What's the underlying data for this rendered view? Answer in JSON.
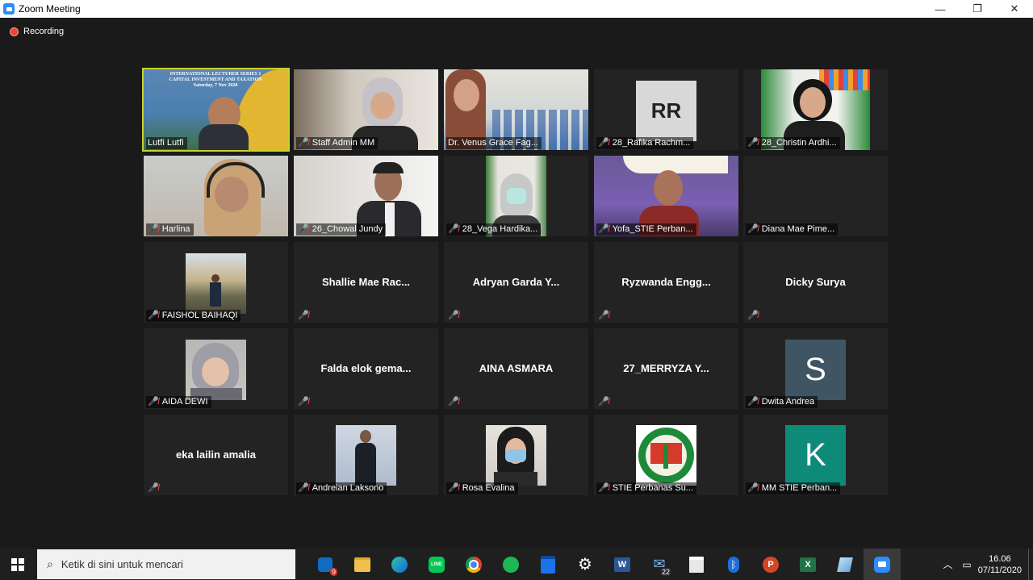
{
  "window": {
    "title": "Zoom Meeting",
    "minimize": "—",
    "maximize": "❐",
    "close": "✕"
  },
  "recording": {
    "label": "Recording"
  },
  "participants": [
    {
      "name": "Lutfi Lutfi",
      "kind": "video",
      "muted": false,
      "active": true
    },
    {
      "name": "Staff Admin MM",
      "kind": "video",
      "muted": true
    },
    {
      "name": "Dr. Venus Grace Fag...",
      "kind": "video",
      "muted": false
    },
    {
      "name": "28_Rafika Rachm...",
      "kind": "avatar",
      "avatar_text": "RR",
      "avatar_color": "#d8d8d8",
      "muted": true
    },
    {
      "name": "28_Christin Ardhi...",
      "kind": "video",
      "muted": true
    },
    {
      "name": "Harlina",
      "kind": "video",
      "muted": true
    },
    {
      "name": "26_Chowal Jundy",
      "kind": "video",
      "muted": true
    },
    {
      "name": "28_Vega Hardika...",
      "kind": "video",
      "muted": true
    },
    {
      "name": "Yofa_STIE Perban...",
      "kind": "video",
      "muted": true
    },
    {
      "name": "Diana Mae Pime...",
      "kind": "blank",
      "muted": true
    },
    {
      "name": "FAISHOL BAIHAQI",
      "kind": "photo",
      "muted": true
    },
    {
      "name": "",
      "big": "Shallie  Mae  Rac...",
      "kind": "text",
      "muted": true
    },
    {
      "name": "",
      "big": "Adryan Garda Y...",
      "kind": "text",
      "muted": true
    },
    {
      "name": "",
      "big": "Ryzwanda  Engg...",
      "kind": "text",
      "muted": true
    },
    {
      "name": "",
      "big": "Dicky Surya",
      "kind": "text",
      "muted": true
    },
    {
      "name": "AIDA DEWI",
      "kind": "photo",
      "muted": true
    },
    {
      "name": "",
      "big": "Falda  elok  gema...",
      "kind": "text",
      "muted": true
    },
    {
      "name": "",
      "big": "AINA ASMARA",
      "kind": "text",
      "muted": true
    },
    {
      "name": "",
      "big": "27_MERRYZA  Y...",
      "kind": "text",
      "muted": true
    },
    {
      "name": "Dwita Andrea",
      "kind": "avatar",
      "avatar_text": "S",
      "avatar_color": "#3f5563",
      "avatar_fg": "#ffffff",
      "muted": true
    },
    {
      "name": "",
      "big": "eka lailin amalia",
      "kind": "text",
      "muted": true
    },
    {
      "name": "Andreian Laksono",
      "kind": "photo",
      "muted": true
    },
    {
      "name": "Rosa Evalina",
      "kind": "photo",
      "muted": true
    },
    {
      "name": "STIE Perbanas Su...",
      "kind": "logo",
      "muted": true
    },
    {
      "name": "MM STIE Perban...",
      "kind": "avatar",
      "avatar_text": "K",
      "avatar_color": "#0e8a7a",
      "avatar_fg": "#ffffff",
      "muted": true
    }
  ],
  "banner": {
    "line1": "INTERNATIONAL LECTURER SERIES 1",
    "line2": "CAPITAL INVESTMENT AND TAXATION",
    "line3": "Saturday, 7 Nov 2020"
  },
  "taskbar": {
    "search_placeholder": "Ketik di sini untuk mencari",
    "mail_count": "22",
    "outlook_count": "9",
    "time": "16.06",
    "date": "07/11/2020"
  },
  "colors": {
    "active_speaker": "#c8d12d",
    "muted_icon": "#e0413b",
    "recording": "#e8453c"
  }
}
